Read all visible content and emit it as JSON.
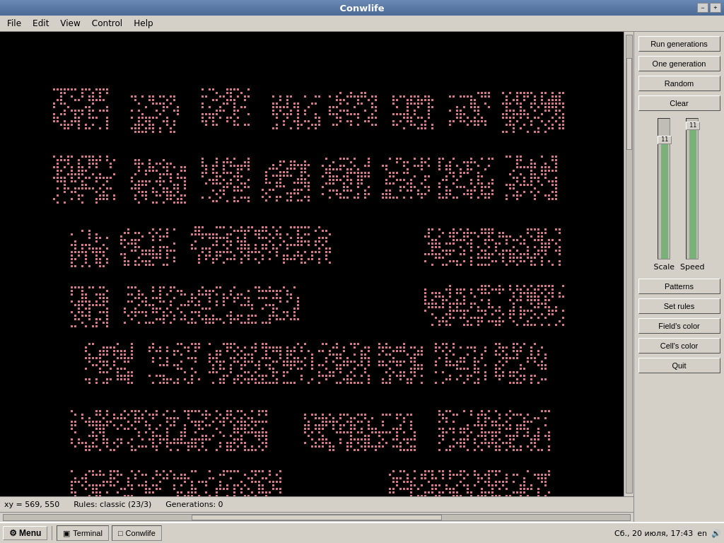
{
  "titleBar": {
    "title": "Conwlife",
    "minimizeBtn": "−",
    "maximizeBtn": "+",
    "closeBtn": "×"
  },
  "menuBar": {
    "items": [
      "File",
      "Edit",
      "View",
      "Control",
      "Help"
    ]
  },
  "rightPanel": {
    "buttons": [
      {
        "id": "run-generations",
        "label": "Run generations"
      },
      {
        "id": "one-generation",
        "label": "One generation"
      },
      {
        "id": "random",
        "label": "Random"
      },
      {
        "id": "clear",
        "label": "Clear"
      }
    ],
    "scaleLabel": "Scale",
    "speedLabel": "Speed",
    "scaleValue": "11",
    "speedValue": "11",
    "bottomButtons": [
      {
        "id": "patterns",
        "label": "Patterns"
      },
      {
        "id": "set-rules",
        "label": "Set rules"
      },
      {
        "id": "fields-color",
        "label": "Field's color"
      },
      {
        "id": "cells-color",
        "label": "Cell's color"
      },
      {
        "id": "quit",
        "label": "Quit"
      }
    ]
  },
  "statusBar": {
    "xy": "xy = 569, 550",
    "rules": "Rules: classic (23/3)",
    "generations": "Generations:  0"
  },
  "taskbar": {
    "startLabel": "Menu",
    "terminalLabel": "Terminal",
    "conwlifeLabel": "Conwlife",
    "datetime": "Сб., 20 июля, 17:43",
    "lang": "en"
  },
  "canvas": {
    "bgColor": "#000000",
    "cellColor": "#d4788a"
  }
}
